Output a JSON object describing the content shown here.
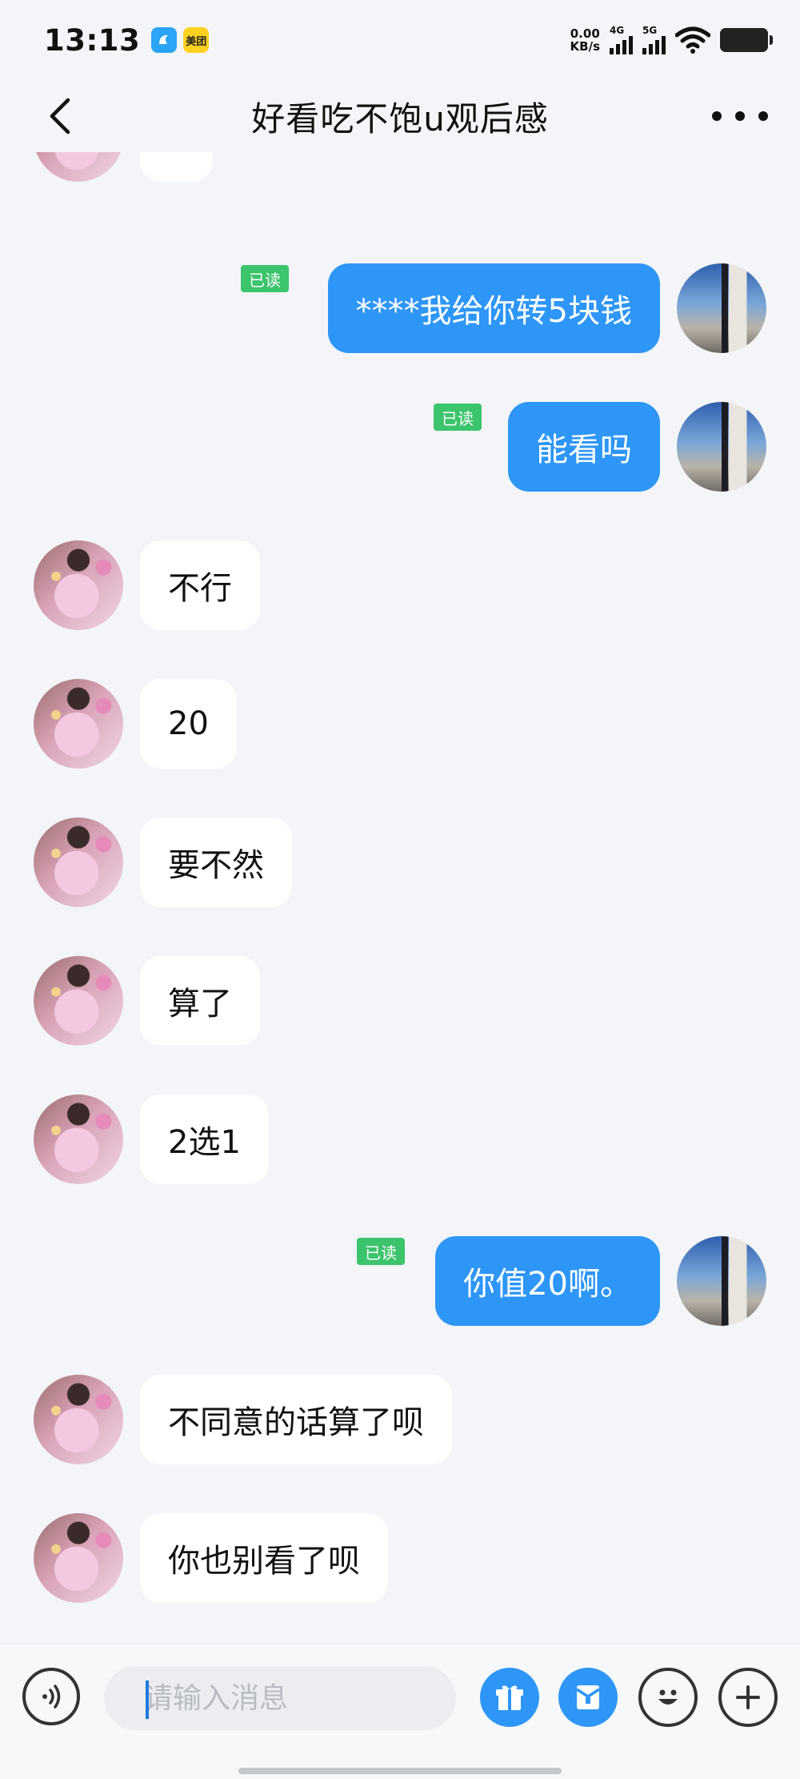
{
  "status_bar": {
    "time": "13:13",
    "app_badges": [
      "dingtalk-style app",
      "美团"
    ],
    "net_speed_value": "0.00",
    "net_speed_unit": "KB/s",
    "signal_1_label": "4G",
    "signal_2_label": "5G"
  },
  "header": {
    "title": "好看吃不饱u观后感"
  },
  "messages": [
    {
      "side": "left",
      "text": "?"
    },
    {
      "side": "right",
      "text": "****我给你转5块钱",
      "read": "已读"
    },
    {
      "side": "right",
      "text": "能看吗",
      "read": "已读"
    },
    {
      "side": "left",
      "text": "不行"
    },
    {
      "side": "left",
      "text": "20"
    },
    {
      "side": "left",
      "text": "要不然"
    },
    {
      "side": "left",
      "text": "算了"
    },
    {
      "side": "left",
      "text": "2选1"
    },
    {
      "side": "right",
      "text": "你值20啊。",
      "read": "已读"
    },
    {
      "side": "left",
      "text": "不同意的话算了呗"
    },
    {
      "side": "left",
      "text": "你也别看了呗"
    }
  ],
  "input": {
    "placeholder": "请输入消息",
    "value": ""
  },
  "colors": {
    "accent": "#2d96f6",
    "read_badge": "#3cc46c",
    "background": "#f3f5f8"
  },
  "icons": [
    "back-arrow-icon",
    "more-dots-icon",
    "voice-icon",
    "gift-icon",
    "red-packet-icon",
    "emoji-icon",
    "plus-icon"
  ]
}
